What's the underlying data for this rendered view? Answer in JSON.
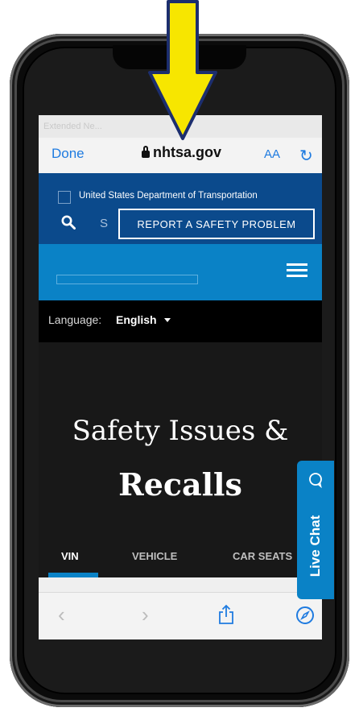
{
  "status_bar": {
    "carrier": "Extended Ne...",
    "time": "",
    "battery": ""
  },
  "browser": {
    "done_label": "Done",
    "url": "nhtsa.gov",
    "aa_label": "AA",
    "reload_glyph": "↻"
  },
  "site": {
    "gov_banner": "United States Department of Transportation",
    "search_placeholder": "S",
    "report_button": "REPORT A SAFETY PROBLEM",
    "language_label": "Language:",
    "language_value": "English",
    "hero_line1": "Safety Issues &",
    "hero_line2": "Recalls",
    "tabs": [
      "VIN",
      "VEHICLE",
      "CAR SEATS"
    ]
  },
  "live_chat": {
    "label": "Live Chat"
  },
  "toolbar": {
    "back_glyph": "‹",
    "forward_glyph": "›"
  },
  "colors": {
    "accent": "#0a82c6",
    "dot_blue": "#0b4a8c",
    "arrow_yellow": "#f7e600",
    "link_blue": "#1f7be0"
  },
  "icons": [
    "lock-icon",
    "reload-icon",
    "search-icon",
    "menu-icon",
    "share-icon",
    "compass-icon",
    "chat-icon",
    "arrow-icon"
  ]
}
